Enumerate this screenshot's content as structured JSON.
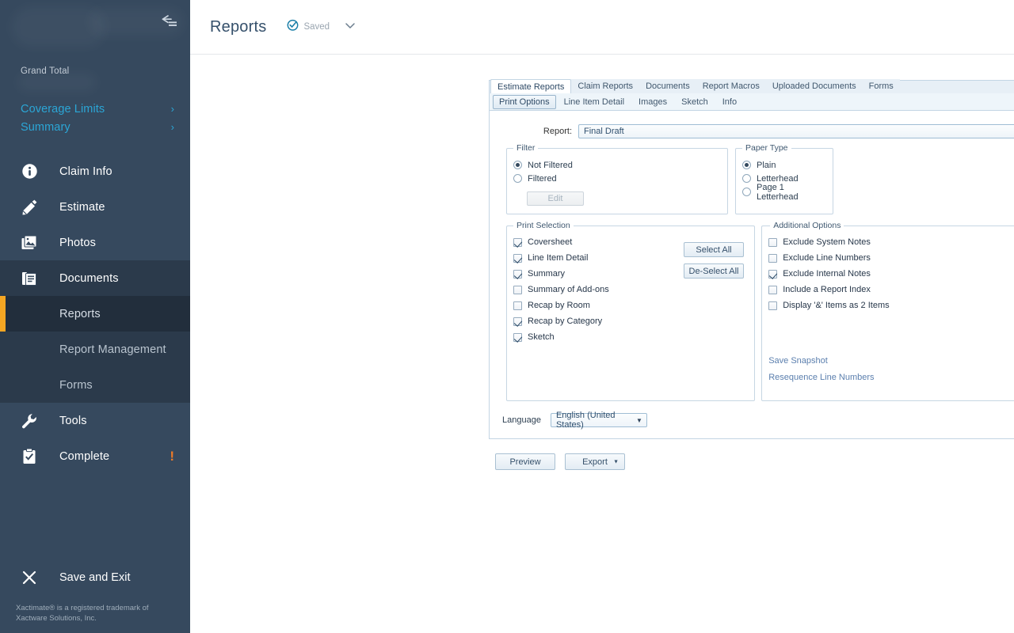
{
  "window": {
    "controls": [
      {
        "name": "minimize",
        "glyph": "–"
      },
      {
        "name": "maximize",
        "glyph": "☐"
      },
      {
        "name": "close",
        "glyph": "✕"
      }
    ]
  },
  "sidebar": {
    "collapse_icon": "collapse-arrow-icon",
    "grand_total_label": "Grand Total",
    "links": [
      {
        "label": "Coverage Limits",
        "chevron": "›"
      },
      {
        "label": "Summary",
        "chevron": "›"
      }
    ],
    "nav": [
      {
        "label": "Claim Info",
        "icon": "info-circle-icon",
        "active": false
      },
      {
        "label": "Estimate",
        "icon": "pencil-edit-icon",
        "active": false
      },
      {
        "label": "Photos",
        "icon": "photos-stack-icon",
        "active": false
      },
      {
        "label": "Documents",
        "icon": "documents-icon",
        "active": true
      }
    ],
    "sub_items": [
      {
        "label": "Reports",
        "active": true
      },
      {
        "label": "Report Management",
        "active": false
      },
      {
        "label": "Forms",
        "active": false
      }
    ],
    "nav_bottom": [
      {
        "label": "Tools",
        "icon": "wrench-icon",
        "badge": ""
      },
      {
        "label": "Complete",
        "icon": "clipboard-check-icon",
        "badge": "!"
      }
    ],
    "save_exit": {
      "label": "Save and Exit",
      "icon": "close-x-icon"
    },
    "trademark": "Xactimate® is a registered trademark of Xactware Solutions, Inc.",
    "accent_color": "#f5a623",
    "background_color": "#36495e"
  },
  "header": {
    "title": "Reports",
    "saved_label": "Saved",
    "saved_icon": "check-circle-icon",
    "chevron_icon": "chevron-down-icon",
    "saved_color": "#1b7fa8"
  },
  "tabs": [
    {
      "label": "Estimate Reports",
      "active": true
    },
    {
      "label": "Claim Reports",
      "active": false
    },
    {
      "label": "Documents",
      "active": false
    },
    {
      "label": "Report Macros",
      "active": false
    },
    {
      "label": "Uploaded Documents",
      "active": false
    },
    {
      "label": "Forms",
      "active": false
    }
  ],
  "subtabs": [
    {
      "label": "Print Options",
      "active": true
    },
    {
      "label": "Line Item Detail",
      "active": false
    },
    {
      "label": "Images",
      "active": false
    },
    {
      "label": "Sketch",
      "active": false
    },
    {
      "label": "Info",
      "active": false
    }
  ],
  "report": {
    "label": "Report:",
    "value": "Final Draft",
    "arrow": "▼"
  },
  "filter": {
    "legend": "Filter",
    "options": [
      {
        "label": "Not Filtered",
        "selected": true
      },
      {
        "label": "Filtered",
        "selected": false
      }
    ],
    "edit_button": "Edit",
    "edit_disabled": true
  },
  "paper_type": {
    "legend": "Paper Type",
    "options": [
      {
        "label": "Plain",
        "selected": true
      },
      {
        "label": "Letterhead",
        "selected": false
      },
      {
        "label": "Page 1 Letterhead",
        "selected": false
      }
    ]
  },
  "print_selection": {
    "legend": "Print Selection",
    "items": [
      {
        "label": "Coversheet",
        "checked": true
      },
      {
        "label": "Line Item Detail",
        "checked": true
      },
      {
        "label": "Summary",
        "checked": true
      },
      {
        "label": "Summary of Add-ons",
        "checked": false
      },
      {
        "label": "Recap by Room",
        "checked": false
      },
      {
        "label": "Recap by Category",
        "checked": true
      },
      {
        "label": "Sketch",
        "checked": true
      }
    ],
    "select_all": "Select All",
    "deselect_all": "De-Select All"
  },
  "additional_options": {
    "legend": "Additional Options",
    "items": [
      {
        "label": "Exclude System Notes",
        "checked": false
      },
      {
        "label": "Exclude Line Numbers",
        "checked": false
      },
      {
        "label": "Exclude Internal Notes",
        "checked": true
      },
      {
        "label": "Include a Report Index",
        "checked": false
      },
      {
        "label": "Display '&' Items as 2 Items",
        "checked": false
      }
    ],
    "links": [
      {
        "label": "Save Snapshot"
      },
      {
        "label": "Resequence Line Numbers"
      }
    ],
    "link_color": "#5b7fae"
  },
  "language": {
    "label": "Language",
    "value": "English (United States)",
    "arrow": "▼"
  },
  "actions": {
    "preview": "Preview",
    "export": "Export",
    "export_caret": "▼"
  }
}
